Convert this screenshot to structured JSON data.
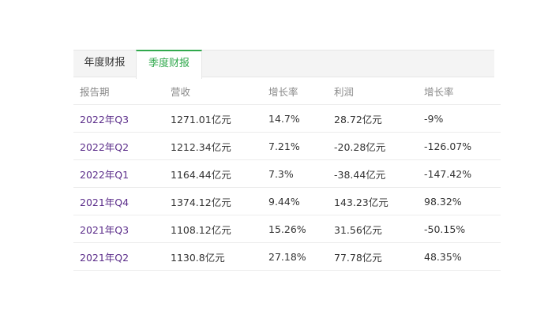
{
  "tabs": {
    "annual_label": "年度财报",
    "quarterly_label": "季度财报"
  },
  "colors": {
    "active_tab": "#31a94d",
    "period_link": "#5b2d8a"
  },
  "table": {
    "headers": [
      "报告期",
      "营收",
      "增长率",
      "利润",
      "增长率"
    ],
    "rows": [
      [
        "2022年Q3",
        "1271.01亿元",
        "14.7%",
        "28.72亿元",
        "-9%"
      ],
      [
        "2022年Q2",
        "1212.34亿元",
        "7.21%",
        "-20.28亿元",
        "-126.07%"
      ],
      [
        "2022年Q1",
        "1164.44亿元",
        "7.3%",
        "-38.44亿元",
        "-147.42%"
      ],
      [
        "2021年Q4",
        "1374.12亿元",
        "9.44%",
        "143.23亿元",
        "98.32%"
      ],
      [
        "2021年Q3",
        "1108.12亿元",
        "15.26%",
        "31.56亿元",
        "-50.15%"
      ],
      [
        "2021年Q2",
        "1130.8亿元",
        "27.18%",
        "77.78亿元",
        "48.35%"
      ]
    ]
  }
}
